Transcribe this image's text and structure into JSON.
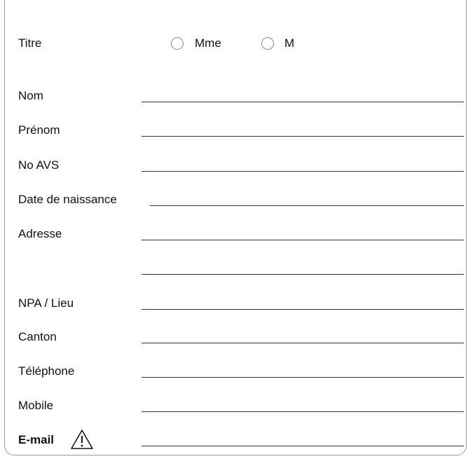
{
  "title": {
    "label": "Titre",
    "options": [
      "Mme",
      "M"
    ]
  },
  "fields": [
    {
      "label": "Nom",
      "value": ""
    },
    {
      "label": "Prénom",
      "value": ""
    },
    {
      "label": "No AVS",
      "value": ""
    },
    {
      "label": "Date de naissance",
      "value": ""
    },
    {
      "label": "Adresse",
      "value": ""
    },
    {
      "label": "",
      "value": ""
    },
    {
      "label": "NPA / Lieu",
      "value": ""
    },
    {
      "label": "Canton",
      "value": ""
    },
    {
      "label": "Téléphone",
      "value": ""
    },
    {
      "label": "Mobile",
      "value": ""
    },
    {
      "label": "E-mail",
      "value": ""
    }
  ],
  "icons": {
    "email_warning": "warning-icon"
  }
}
